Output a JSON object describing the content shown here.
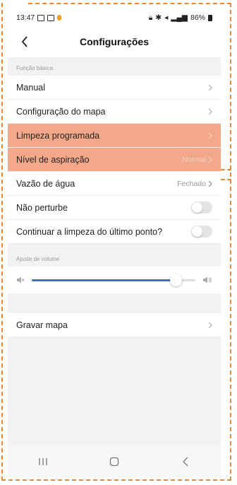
{
  "status": {
    "time": "13:47",
    "battery": "86%"
  },
  "header": {
    "title": "Configurações"
  },
  "basic": {
    "label": "Função básica",
    "manual": "Manual",
    "map_config": "Configuração do mapa",
    "scheduled": "Limpeza programada",
    "suction": "Nível de aspiração",
    "suction_value": "Normal",
    "water": "Vazão de água",
    "water_value": "Fechado",
    "dnd": "Não perturbe",
    "resume": "Continuar a limpeza do último ponto?"
  },
  "volume": {
    "label": "Ajuste de volume",
    "level": 0.88
  },
  "map": {
    "save": "Gravar mapa"
  },
  "colors": {
    "highlight": "#f3a88a",
    "accent": "#2a7ad4",
    "annotation": "#f0882a"
  },
  "icons": {
    "back": "chevron-left-icon",
    "chevron": "chevron-right-icon",
    "vol_low": "volume-mute-icon",
    "vol_high": "volume-high-icon",
    "nav_recent": "recent-apps-icon",
    "nav_home": "home-icon",
    "nav_back": "back-icon"
  }
}
